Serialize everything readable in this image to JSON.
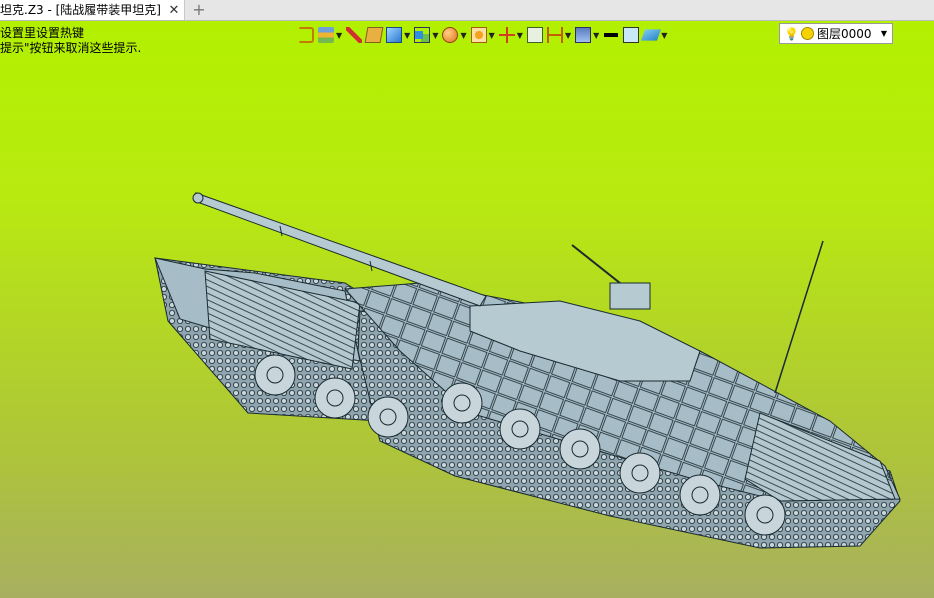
{
  "tab": {
    "title": "坦克.Z3 - [陆战履带装甲坦克]",
    "close_icon": "close-icon",
    "add_icon": "plus-icon"
  },
  "hints": {
    "line1": "设置里设置热键",
    "line2": "提示\"按钮来取消这些提示."
  },
  "toolbar": {
    "icons": [
      "undo-icon",
      "layers-icon",
      "pen-icon",
      "box-icon",
      "cube-icon",
      "render-icon",
      "sphere-icon",
      "texture-icon",
      "snap-icon",
      "frame-icon",
      "dimension-icon",
      "display-icon",
      "line-color-icon",
      "fill-color-icon",
      "layer-stack-icon"
    ],
    "layer_select": {
      "value": "图层0000",
      "bulb_icon": "lightbulb-icon",
      "state_icon": "layer-state-icon"
    }
  },
  "colors": {
    "viewport_top": "#b2f000",
    "viewport_bottom": "#a8b060",
    "model": "#a6bcc6",
    "edges": "#1a2a30"
  }
}
